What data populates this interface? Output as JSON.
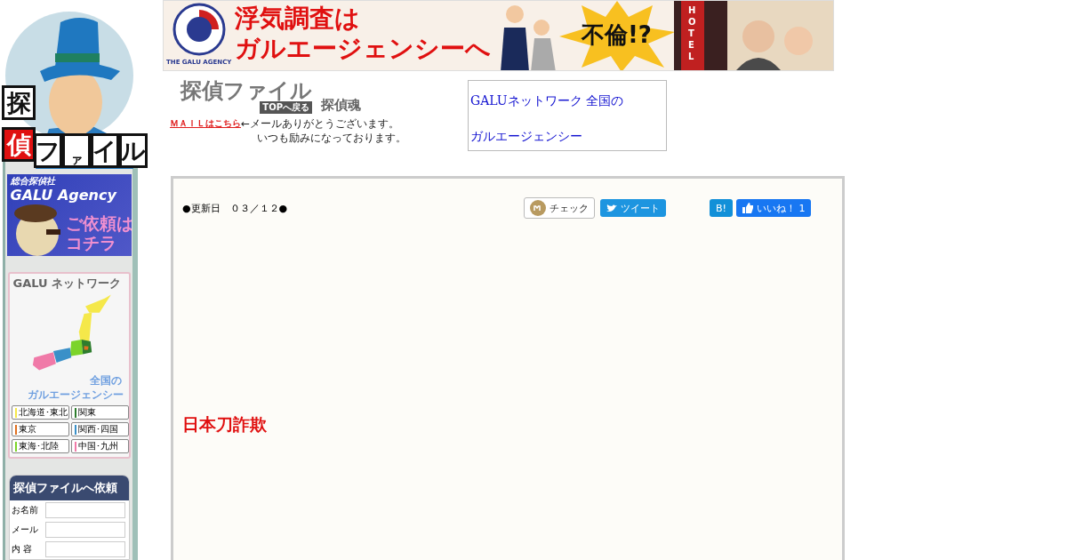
{
  "logo": {
    "chars": [
      "探",
      "偵",
      "フ",
      "ァ",
      "イ",
      "ル"
    ]
  },
  "banner": {
    "emblem": "THE GALU AGENCY",
    "headline_1": "浮気調査は",
    "headline_2": "ガルエージェンシーへ",
    "burst": "不倫!?",
    "sign": "HOTEL"
  },
  "header": {
    "title_logo": {
      "main": "探偵ファイル",
      "sub": "TOPへ戻る"
    },
    "tagline": "探偵魂",
    "mail_link": "ＭＡＩＬはこちら",
    "mail_note": [
      "←メールありがとうございます。",
      "いつも励みになっております。"
    ],
    "broken_image": {
      "alt_1": "GALUネットワーク 全国の",
      "alt_2": "ガルエージェンシー"
    }
  },
  "sidebar": {
    "agency_banner": {
      "small": "総合探偵社",
      "name": "GALU Agency",
      "cta_1": "ご依頼は",
      "cta_2": "コチラ"
    },
    "network": {
      "title": "GALU ネットワーク",
      "caption_1": "全国の",
      "caption_2": "ガルエージェンシー",
      "regions": [
        {
          "label": "北海道･東北",
          "color": "#f5e84a"
        },
        {
          "label": "関東",
          "color": "#2e7d2e"
        },
        {
          "label": "東京",
          "color": "#e07020"
        },
        {
          "label": "関西･四国",
          "color": "#3a90c8"
        },
        {
          "label": "東海･北陸",
          "color": "#7cd42a"
        },
        {
          "label": "中国･九州",
          "color": "#f07aa8"
        }
      ]
    },
    "form": {
      "title": "探偵ファイルへ依頼",
      "fields": [
        {
          "label": "お名前"
        },
        {
          "label": "メール"
        },
        {
          "label": "内 容"
        }
      ]
    }
  },
  "content": {
    "updated": "●更新日　０３／１２●",
    "share": [
      {
        "kind": "check",
        "label": "チェック"
      },
      {
        "kind": "tweet",
        "label": "ツイート"
      },
      {
        "kind": "hatena",
        "label": "B!"
      },
      {
        "kind": "like",
        "label": "いいね！ 1"
      }
    ],
    "article_title": "日本刀詐欺"
  }
}
